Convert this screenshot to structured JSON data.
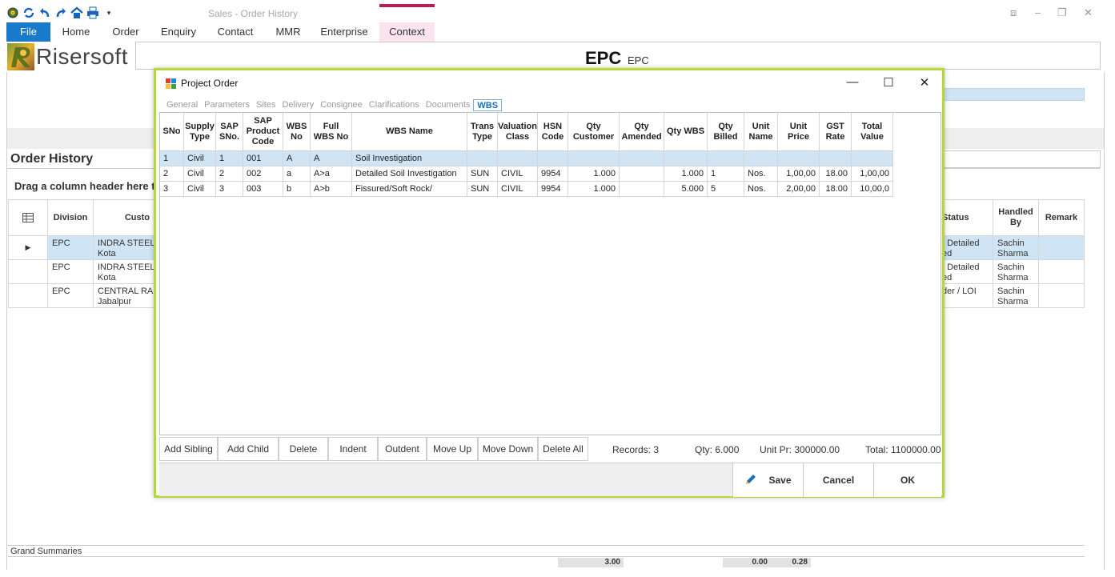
{
  "window": {
    "title": "Sales - Order History",
    "controls": [
      "⧈",
      "–",
      "❐",
      "✕"
    ]
  },
  "ribbon": {
    "tabs": [
      "File",
      "Home",
      "Order",
      "Enquiry",
      "Contact",
      "MMR",
      "Enterprise",
      "Context"
    ]
  },
  "brand": {
    "logo_text": "Risersoft"
  },
  "header": {
    "title": "EPC",
    "subtitle": "EPC"
  },
  "order_history": {
    "title": "Order History",
    "drag_hint": "Drag a column header here to g",
    "columns": [
      "",
      "Division",
      "Custo",
      "Status",
      "Handled By",
      "Remark"
    ],
    "rows": [
      {
        "division": "EPC",
        "customer": "INDRA STEEL\nKota",
        "status": "/ Detailed\ned",
        "handled_by": "Sachin\nSharma",
        "remark": ""
      },
      {
        "division": "EPC",
        "customer": "INDRA STEEL\nKota",
        "status": "/ Detailed\ned",
        "handled_by": "Sachin\nSharma",
        "remark": ""
      },
      {
        "division": "EPC",
        "customer": "CENTRAL RA\nJabalpur",
        "status": "der / LOI",
        "handled_by": "Sachin\nSharma",
        "remark": ""
      }
    ],
    "grand_summaries": "Grand Summaries",
    "summary_values": [
      "3.00",
      "0.00",
      "0.28"
    ]
  },
  "dialog": {
    "title": "Project Order",
    "tabs": [
      "General",
      "Parameters",
      "Sites",
      "Delivery",
      "Consignee",
      "Clarifications",
      "Documents",
      "WBS"
    ],
    "active_tab": "WBS",
    "columns": [
      "SNo",
      "Supply Type",
      "SAP SNo.",
      "SAP Product Code",
      "WBS No",
      "Full WBS No",
      "WBS Name",
      "Trans Type",
      "Valuation Class",
      "HSN Code",
      "Qty Customer",
      "Qty Amended",
      "Qty WBS",
      "Qty Billed",
      "Unit Name",
      "Unit Price",
      "GST Rate",
      "Total Value"
    ],
    "rows": [
      [
        "1",
        "Civil",
        "1",
        "001",
        "A",
        "A",
        "Soil Investigation",
        "",
        "",
        "",
        "",
        "",
        "",
        "",
        "",
        "",
        "",
        ""
      ],
      [
        "2",
        "Civil",
        "2",
        "002",
        "a",
        "A>a",
        "Detailed Soil Investigation",
        "SUN",
        "CIVIL",
        "9954",
        "1.000",
        "",
        "1.000",
        "1",
        "Nos.",
        "1,00,00",
        "18.00",
        "1,00,00"
      ],
      [
        "3",
        "Civil",
        "3",
        "003",
        "b",
        "A>b",
        "Fissured/Soft Rock/",
        "SUN",
        "CIVIL",
        "9954",
        "1.000",
        "",
        "5.000",
        "5",
        "Nos.",
        "2,00,00",
        "18.00",
        "10,00,0"
      ]
    ],
    "buttons": [
      "Add Sibling",
      "Add Child",
      "Delete",
      "Indent",
      "Outdent",
      "Move Up",
      "Move Down",
      "Delete All"
    ],
    "records": "Records: 3",
    "qty": "Qty: 6.000",
    "unit_price": "Unit Pr: 300000.00",
    "total": "Total: 1100000.00",
    "footer_buttons": {
      "save": "Save",
      "cancel": "Cancel",
      "ok": "OK"
    }
  },
  "colors": {
    "accent": "#1979ca",
    "dialog_border": "#b5d934",
    "selection": "#cfe5f6",
    "context": "#c2185b"
  }
}
